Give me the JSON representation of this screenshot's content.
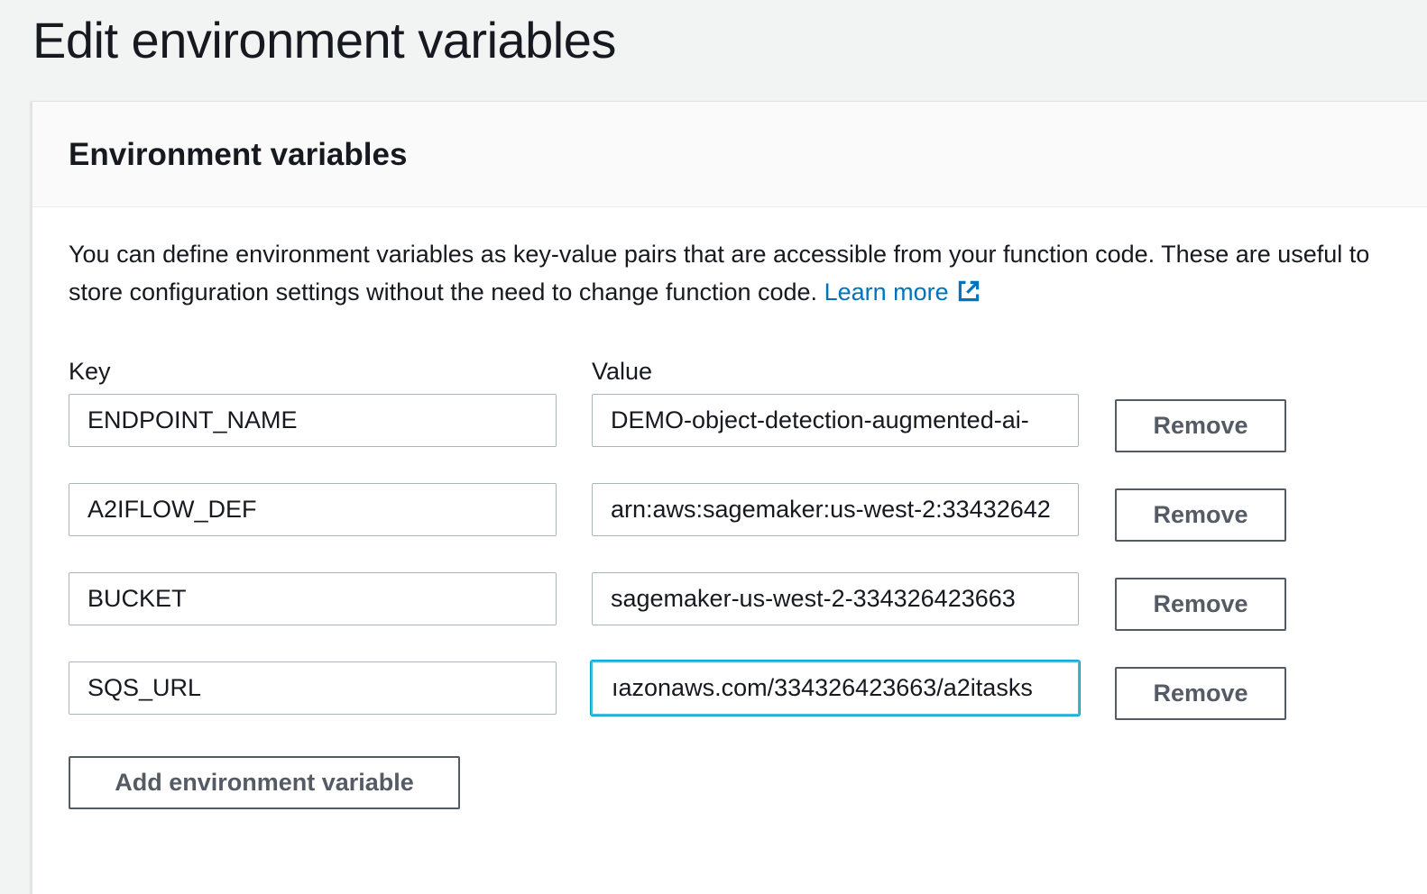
{
  "page": {
    "title": "Edit environment variables"
  },
  "panel": {
    "title": "Environment variables",
    "description_line1": "You can define environment variables as key-value pairs that are accessible from your function code. These are useful to",
    "description_line2": "store configuration settings without the need to change function code.",
    "learn_more": "Learn more"
  },
  "columns": {
    "key_label": "Key",
    "value_label": "Value"
  },
  "variables": [
    {
      "key": "ENDPOINT_NAME",
      "value": "DEMO-object-detection-augmented-ai-",
      "remove_label": "Remove"
    },
    {
      "key": "A2IFLOW_DEF",
      "value": "arn:aws:sagemaker:us-west-2:33432642",
      "remove_label": "Remove"
    },
    {
      "key": "BUCKET",
      "value": "sagemaker-us-west-2-334326423663",
      "remove_label": "Remove"
    },
    {
      "key": "SQS_URL",
      "value": "ıazonaws.com/334326423663/a2itasks",
      "remove_label": "Remove"
    }
  ],
  "actions": {
    "add_label": "Add environment variable"
  },
  "colors": {
    "accent_link": "#0073bb",
    "focus_border": "#44b9d6",
    "button_border": "#545b64"
  },
  "icons": {
    "learn_more": "external-link-icon"
  }
}
